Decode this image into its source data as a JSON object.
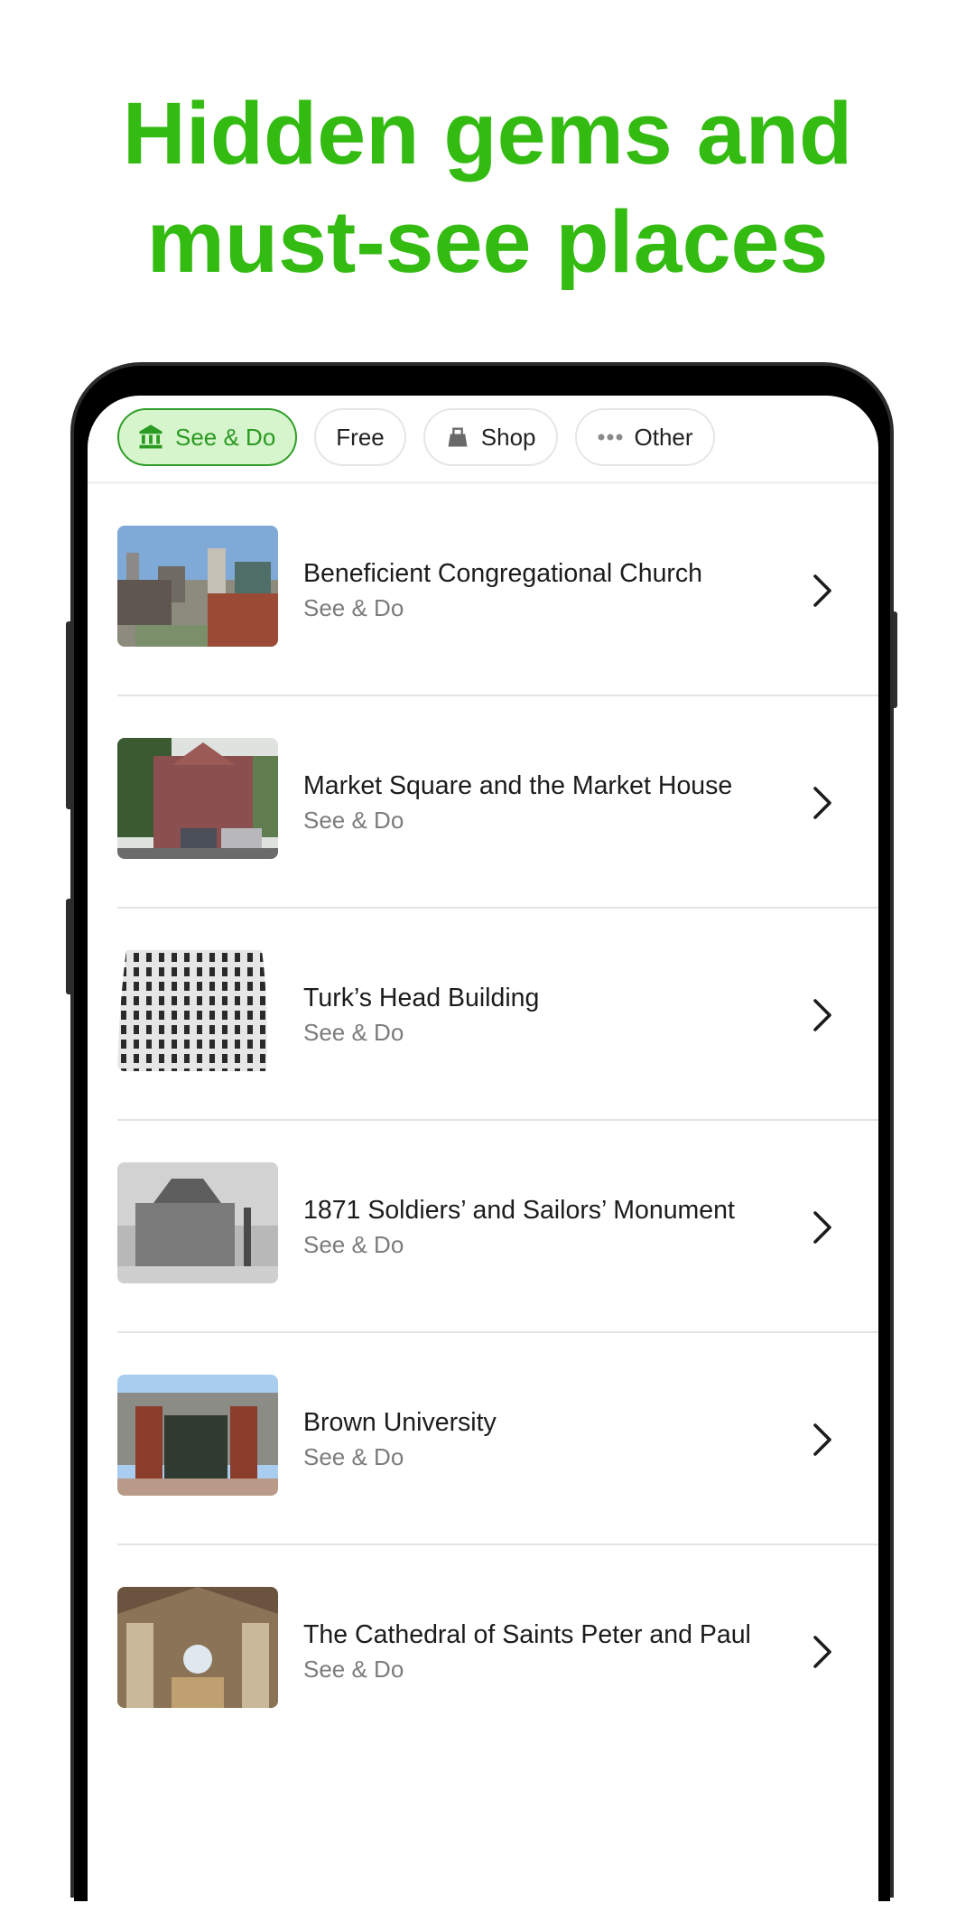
{
  "headline": {
    "line1": "Hidden gems and",
    "line2": "must-see places",
    "color": "#33bb12"
  },
  "filters": [
    {
      "label": "See & Do",
      "icon": "museum-icon",
      "active": true
    },
    {
      "label": "Free",
      "icon": null,
      "active": false
    },
    {
      "label": "Shop",
      "icon": "shopping-bag-icon",
      "active": false
    },
    {
      "label": "Other",
      "icon": "more-dots-icon",
      "active": false
    }
  ],
  "places": [
    {
      "title": "Beneficient Congregational Church",
      "category": "See & Do",
      "thumbnail": "city-church-aerial-photo"
    },
    {
      "title": "Market Square and the Market House",
      "category": "See & Do",
      "thumbnail": "brick-market-house-photo"
    },
    {
      "title": "Turk’s Head Building",
      "category": "See & Do",
      "thumbnail": "curved-tower-photo"
    },
    {
      "title": "1871 Soldiers’ and Sailors’ Monument",
      "category": "See & Do",
      "thumbnail": "historic-city-hall-bw-photo"
    },
    {
      "title": "Brown University",
      "category": "See & Do",
      "thumbnail": "university-gate-photo"
    },
    {
      "title": "The Cathedral of Saints Peter and Paul",
      "category": "See & Do",
      "thumbnail": "cathedral-interior-photo"
    }
  ],
  "colors": {
    "accent": "#2b9a22",
    "accent_bg": "#d6f5cc",
    "headline": "#33bb12"
  }
}
